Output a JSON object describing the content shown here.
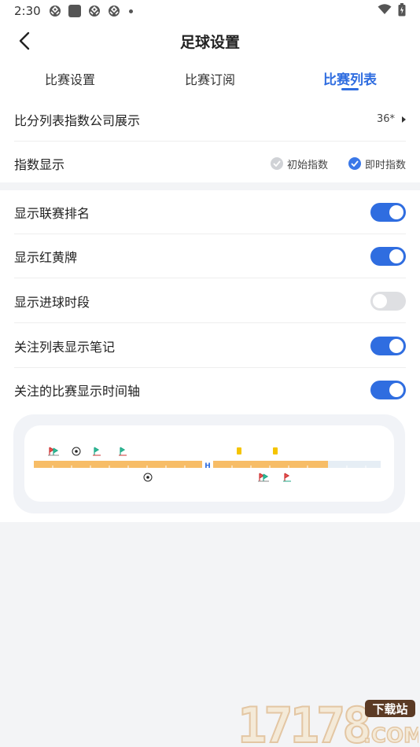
{
  "status_bar": {
    "time": "2:30"
  },
  "header": {
    "title": "足球设置",
    "back_icon": "chevron-left-icon"
  },
  "tabs": [
    {
      "label": "比赛设置",
      "active": false
    },
    {
      "label": "比赛订阅",
      "active": false
    },
    {
      "label": "比赛列表",
      "active": true
    }
  ],
  "settings_group1": {
    "company_display": {
      "label": "比分列表指数公司展示",
      "value": "36*"
    },
    "index_display": {
      "label": "指数显示",
      "options": [
        {
          "label": "初始指数",
          "checked": false
        },
        {
          "label": "即时指数",
          "checked": true
        }
      ]
    }
  },
  "settings_group2": {
    "toggles": [
      {
        "label": "显示联赛排名",
        "on": true
      },
      {
        "label": "显示红黄牌",
        "on": true
      },
      {
        "label": "显示进球时段",
        "on": false
      },
      {
        "label": "关注列表显示笔记",
        "on": true
      },
      {
        "label": "关注的比赛显示时间轴",
        "on": true
      }
    ]
  },
  "timeline_preview": {
    "half_marker": "H"
  },
  "colors": {
    "accent": "#2f6de0",
    "timeline_bar": "#f7bd67",
    "timeline_rest": "#e6eef5",
    "yellow_card": "#f5c400"
  },
  "watermark": {
    "number": "17178",
    "tag": "下载站",
    "suffix": ".COM"
  }
}
